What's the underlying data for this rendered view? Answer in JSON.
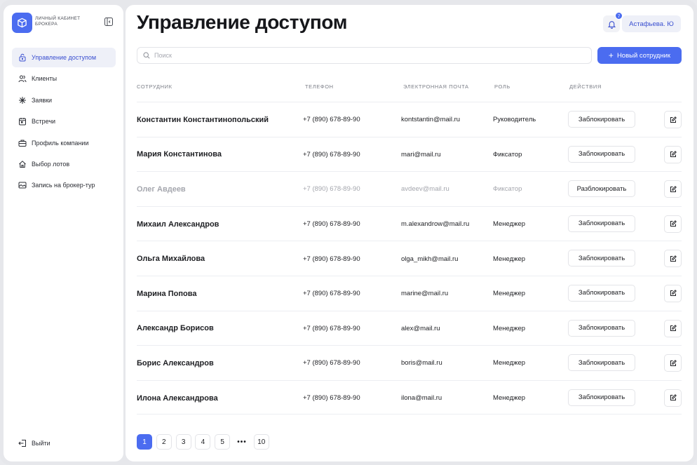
{
  "colors": {
    "accent": "#4b6cf0",
    "active_nav_bg": "#eef0f8",
    "muted_text": "#a4a6ad"
  },
  "brand": {
    "line1": "ЛИЧНЫЙ КАБИНЕТ",
    "line2": "БРОКЕРА",
    "icon": "box-icon"
  },
  "sidebar": {
    "items": [
      {
        "label": "Управление доступом",
        "icon": "lock-open-icon",
        "active": true
      },
      {
        "label": "Клиенты",
        "icon": "users-icon"
      },
      {
        "label": "Заявки",
        "icon": "sparkle-icon"
      },
      {
        "label": "Встречи",
        "icon": "calendar-icon"
      },
      {
        "label": "Профиль компании",
        "icon": "briefcase-icon"
      },
      {
        "label": "Выбор лотов",
        "icon": "house-icon"
      },
      {
        "label": "Запись на брокер-тур",
        "icon": "image-icon"
      }
    ],
    "logout": "Выйти"
  },
  "header": {
    "title": "Управление доступом",
    "notifications_count": "7",
    "user": "Астафьева. Ю"
  },
  "search": {
    "placeholder": "Поиск",
    "value": ""
  },
  "new_employee": "Новый сотрудник",
  "table": {
    "columns": [
      "СОТРУДНИК",
      "ТЕЛЕФОН",
      "ЭЛЕКТРОННАЯ ПОЧТА",
      "РОЛЬ",
      "ДЕЙСТВИЯ"
    ],
    "rows": [
      {
        "name": "Константин Константинопольский",
        "phone": "+7 (890) 678-89-90",
        "email": "kontstantin@mail.ru",
        "role": "Руководитель",
        "action": "Заблокировать"
      },
      {
        "name": "Мария Константинова",
        "phone": "+7 (890) 678-89-90",
        "email": "mari@mail.ru",
        "role": "Фиксатор",
        "action": "Заблокировать"
      },
      {
        "name": "Олег Авдеев",
        "phone": "+7 (890) 678-89-90",
        "email": "avdeev@mail.ru",
        "role": "Фиксатор",
        "action": "Разблокировать",
        "blocked": true
      },
      {
        "name": "Михаил Александров",
        "phone": "+7 (890) 678-89-90",
        "email": "m.alexandrow@mail.ru",
        "role": "Менеджер",
        "action": "Заблокировать"
      },
      {
        "name": "Ольга Михайлова",
        "phone": "+7 (890) 678-89-90",
        "email": "olga_mikh@mail.ru",
        "role": "Менеджер",
        "action": "Заблокировать"
      },
      {
        "name": "Марина Попова",
        "phone": "+7 (890) 678-89-90",
        "email": "marine@mail.ru",
        "role": "Менеджер",
        "action": "Заблокировать"
      },
      {
        "name": "Александр Борисов",
        "phone": "+7 (890) 678-89-90",
        "email": "alex@mail.ru",
        "role": "Менеджер",
        "action": "Заблокировать"
      },
      {
        "name": "Борис Александров",
        "phone": "+7 (890) 678-89-90",
        "email": "boris@mail.ru",
        "role": "Менеджер",
        "action": "Заблокировать"
      },
      {
        "name": "Илона Александрова",
        "phone": "+7 (890) 678-89-90",
        "email": "ilona@mail.ru",
        "role": "Менеджер",
        "action": "Заблокировать"
      }
    ]
  },
  "pagination": {
    "pages": [
      "1",
      "2",
      "3",
      "4",
      "5",
      "•••",
      "10"
    ],
    "current": "1"
  }
}
